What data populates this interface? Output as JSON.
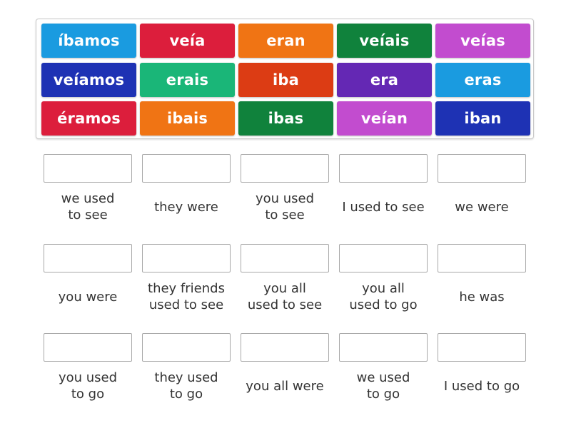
{
  "tiles": [
    {
      "text": "íbamos",
      "color": "#1a9be0"
    },
    {
      "text": "veía",
      "color": "#dc1e3c"
    },
    {
      "text": "eran",
      "color": "#f07414"
    },
    {
      "text": "veíais",
      "color": "#10823c"
    },
    {
      "text": "veías",
      "color": "#c24ccf"
    },
    {
      "text": "veíamos",
      "color": "#1e32b4"
    },
    {
      "text": "erais",
      "color": "#1ab678"
    },
    {
      "text": "iba",
      "color": "#dc3c14"
    },
    {
      "text": "era",
      "color": "#6428b4"
    },
    {
      "text": "eras",
      "color": "#1a9be0"
    },
    {
      "text": "éramos",
      "color": "#dc1e3c"
    },
    {
      "text": "ibais",
      "color": "#f07414"
    },
    {
      "text": "ibas",
      "color": "#10823c"
    },
    {
      "text": "veían",
      "color": "#c24ccf"
    },
    {
      "text": "iban",
      "color": "#1e32b4"
    }
  ],
  "targets": [
    {
      "label": "we used\nto see"
    },
    {
      "label": "they were"
    },
    {
      "label": "you used\nto see"
    },
    {
      "label": "I used to see"
    },
    {
      "label": "we were"
    },
    {
      "label": "you were"
    },
    {
      "label": "they friends\nused to see"
    },
    {
      "label": "you all\nused to see"
    },
    {
      "label": "you all\nused to go"
    },
    {
      "label": "he was"
    },
    {
      "label": "you used\nto go"
    },
    {
      "label": "they used\nto go"
    },
    {
      "label": "you all were"
    },
    {
      "label": "we used\nto go"
    },
    {
      "label": "I used to go"
    }
  ]
}
